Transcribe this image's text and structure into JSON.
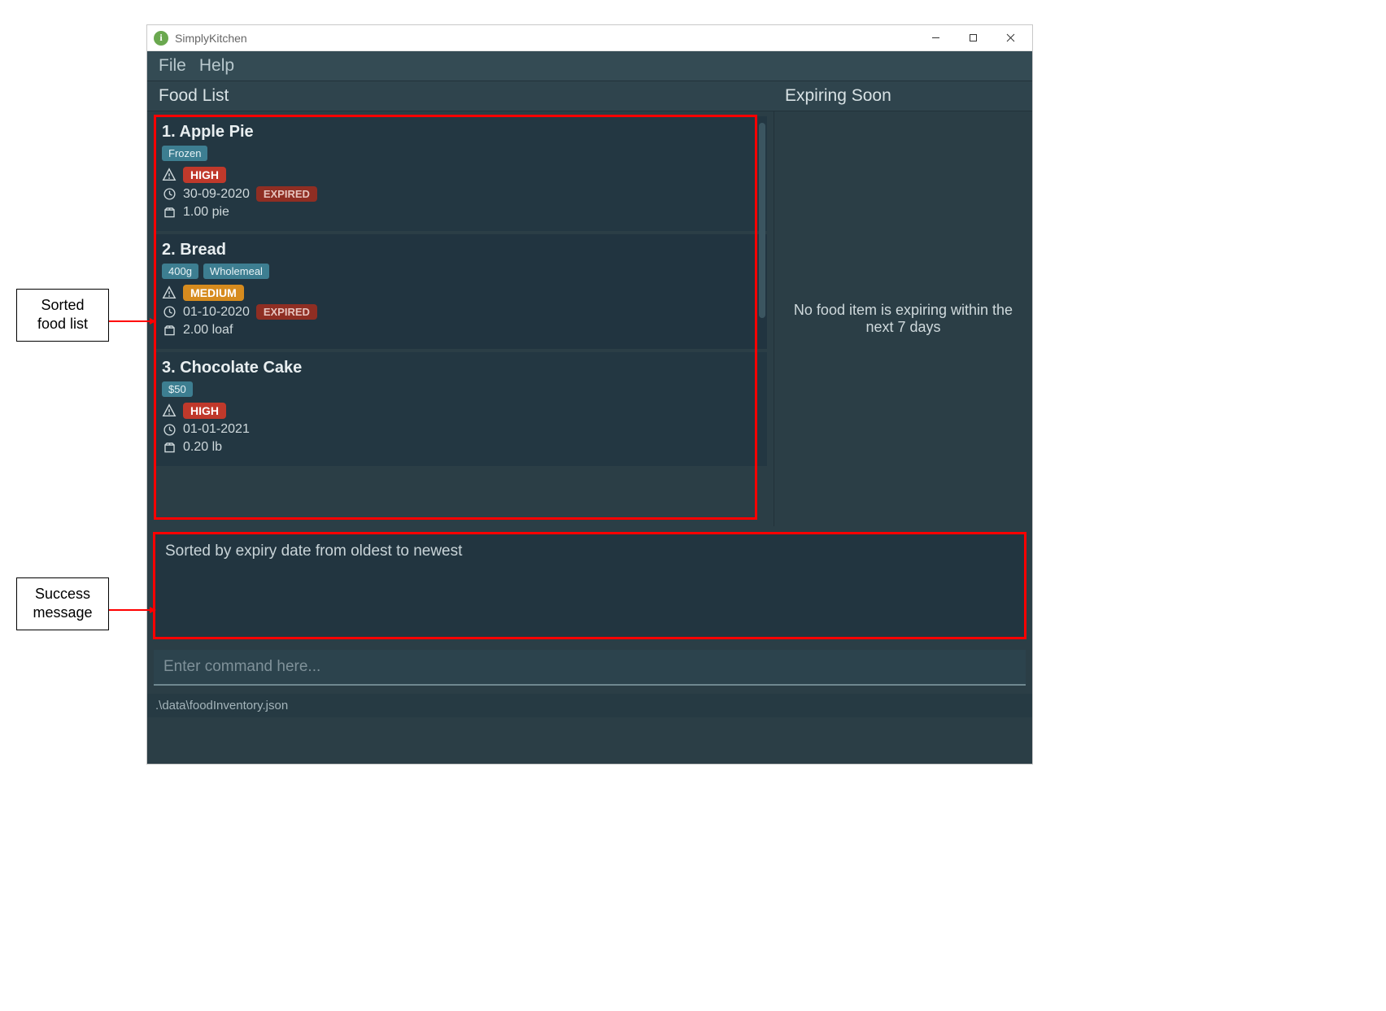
{
  "callouts": {
    "sorted": "Sorted\nfood list",
    "success": "Success\nmessage"
  },
  "window": {
    "title": "SimplyKitchen",
    "icon_letter": "i"
  },
  "menubar": {
    "file": "File",
    "help": "Help"
  },
  "headers": {
    "left": "Food List",
    "right": "Expiring Soon"
  },
  "food_items": [
    {
      "index": "1.",
      "name": "Apple Pie",
      "tags": [
        "Frozen"
      ],
      "priority": "HIGH",
      "priority_class": "high",
      "expiry": "30-09-2020",
      "expired": true,
      "quantity": "1.00 pie"
    },
    {
      "index": "2.",
      "name": "Bread",
      "tags": [
        "400g",
        "Wholemeal"
      ],
      "priority": "MEDIUM",
      "priority_class": "medium",
      "expiry": "01-10-2020",
      "expired": true,
      "quantity": "2.00 loaf"
    },
    {
      "index": "3.",
      "name": "Chocolate Cake",
      "tags": [
        "$50"
      ],
      "priority": "HIGH",
      "priority_class": "high",
      "expiry": "01-01-2021",
      "expired": false,
      "quantity": "0.20 lb"
    }
  ],
  "expiring_panel": {
    "empty_text": "No food item is expiring within the next 7 days"
  },
  "result": {
    "message": "Sorted by expiry date from oldest to newest"
  },
  "command": {
    "placeholder": "Enter command here..."
  },
  "status": {
    "path": ".\\data\\foodInventory.json"
  },
  "labels": {
    "expired_badge": "EXPIRED"
  }
}
